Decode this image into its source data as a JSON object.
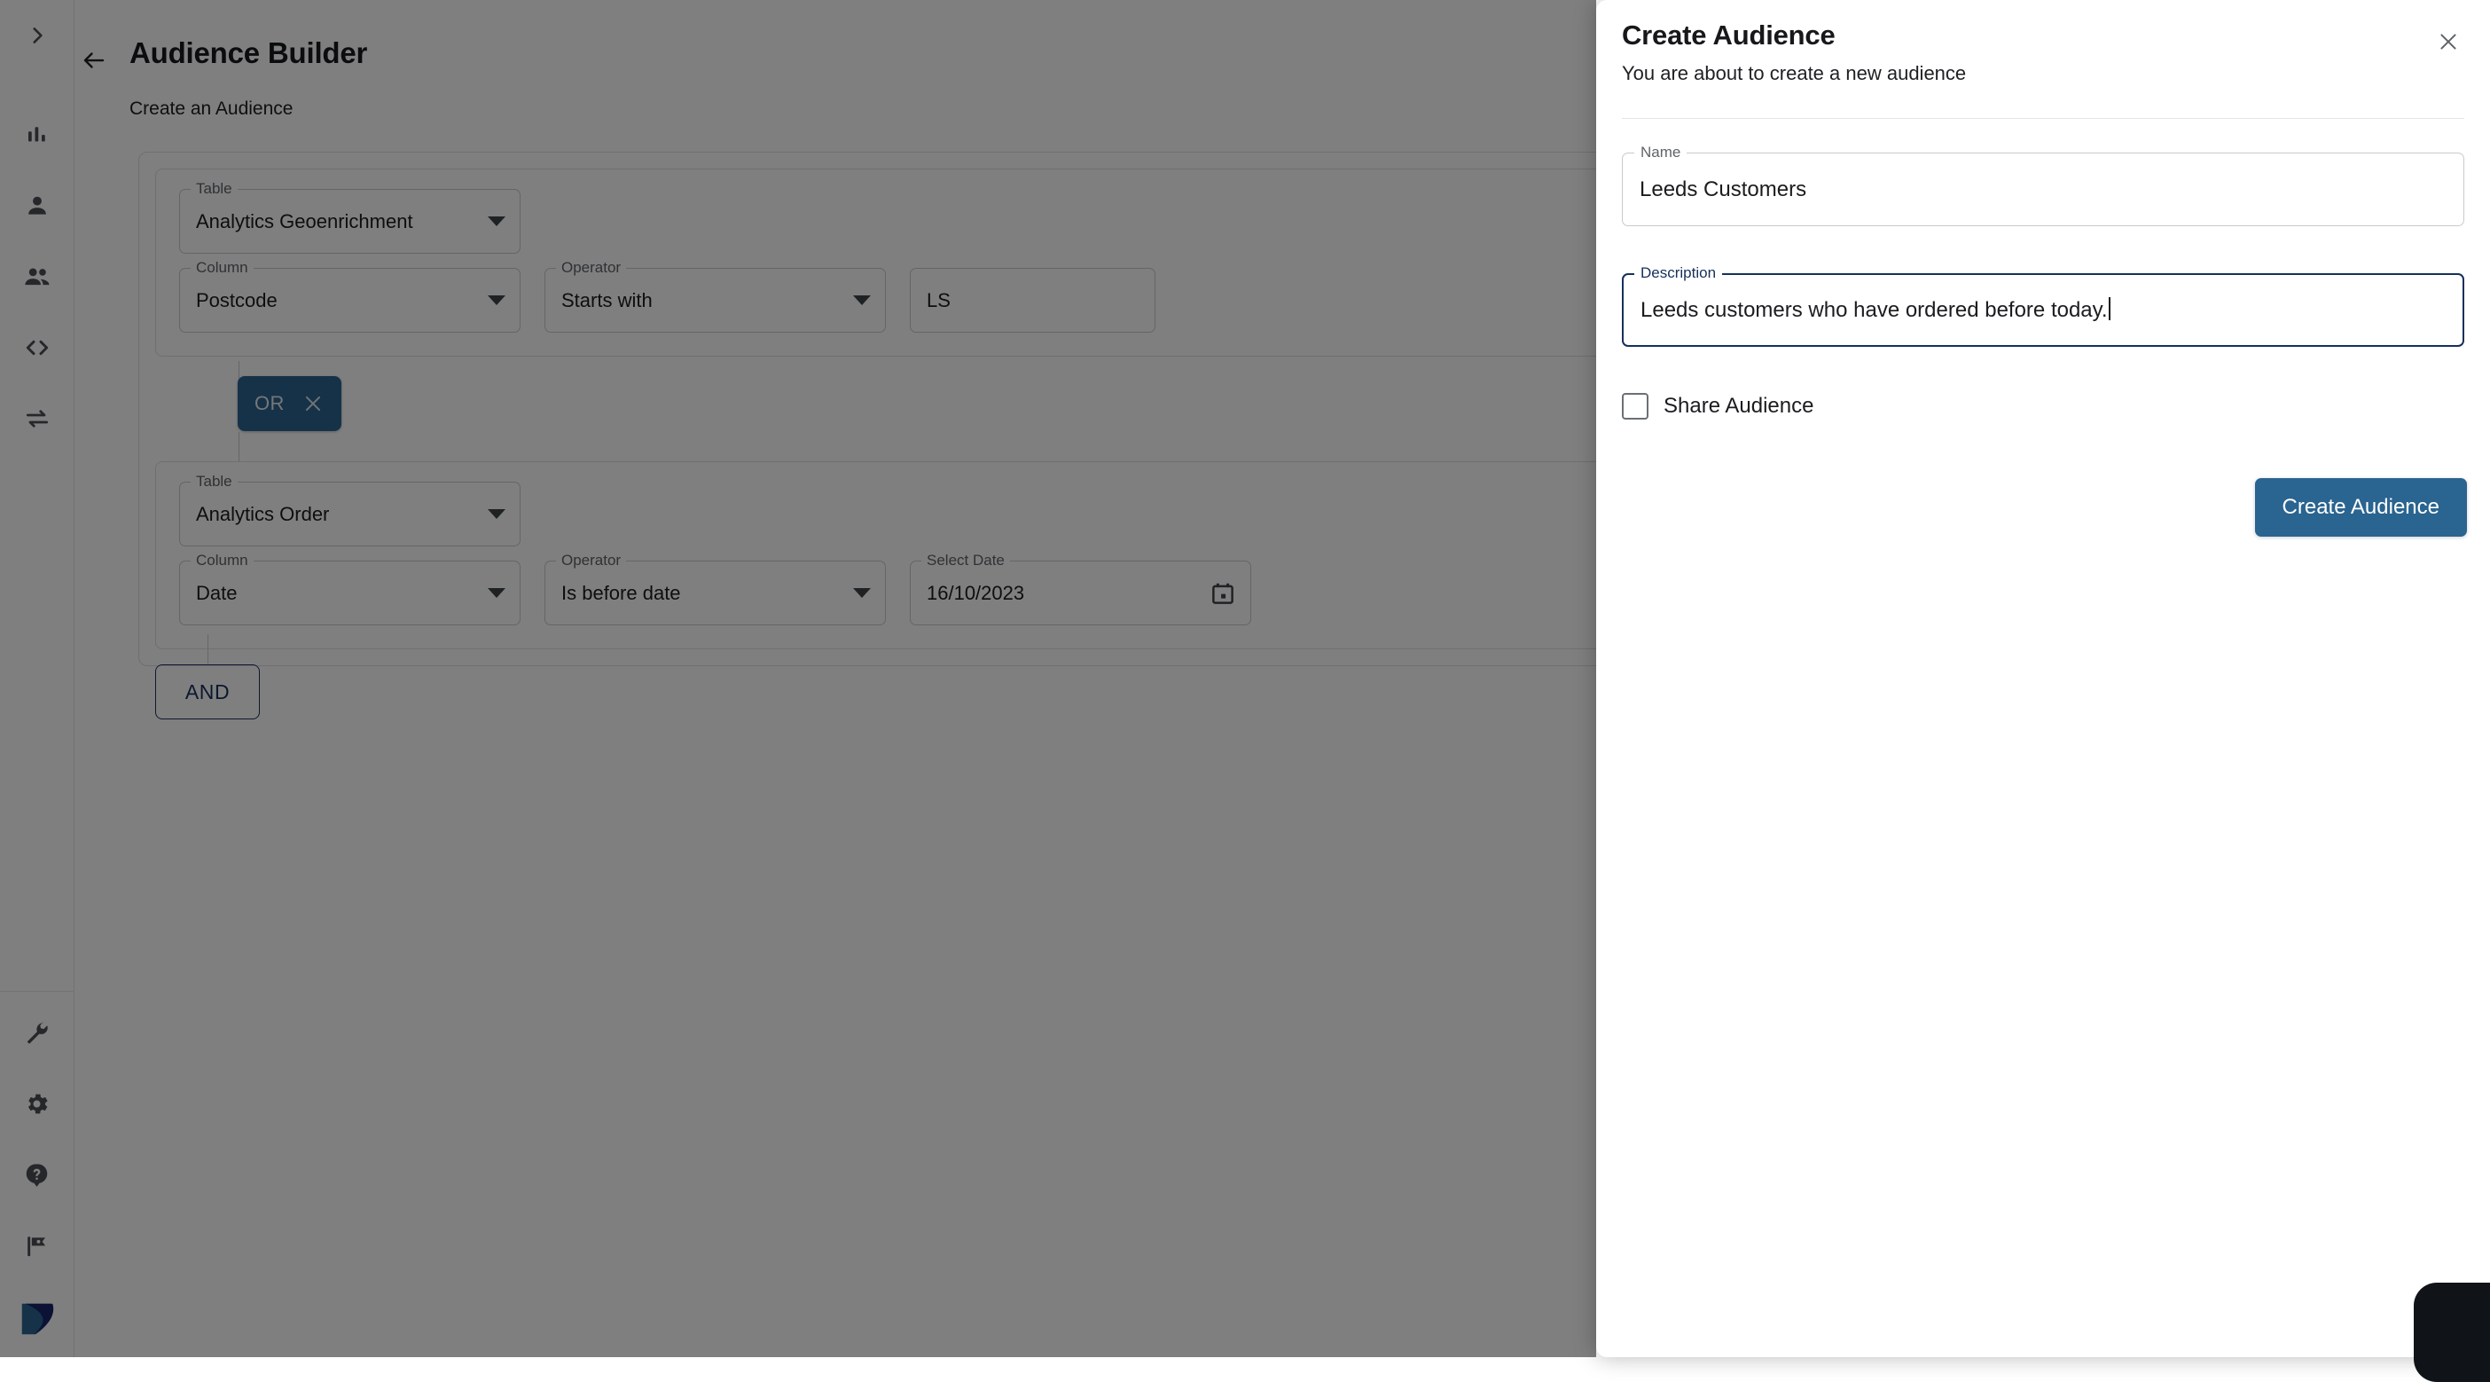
{
  "sidebar": {
    "expand_icon": "chevron-right-icon",
    "items": [
      {
        "icon": "bar-chart-icon",
        "name": "analytics"
      },
      {
        "icon": "person-icon",
        "name": "profile"
      },
      {
        "icon": "people-icon",
        "name": "audiences"
      },
      {
        "icon": "code-brackets-icon",
        "name": "developer"
      },
      {
        "icon": "sync-arrows-icon",
        "name": "integrations"
      }
    ],
    "bottom_items": [
      {
        "icon": "wrench-icon",
        "name": "tools"
      },
      {
        "icon": "gear-icon",
        "name": "settings"
      },
      {
        "icon": "help-circle-icon",
        "name": "help"
      },
      {
        "icon": "flag-icon",
        "name": "feedback"
      }
    ],
    "logo": "app-logo"
  },
  "page": {
    "back_icon": "arrow-left-icon",
    "title": "Audience Builder",
    "subtitle": "Create an Audience"
  },
  "builder": {
    "groups": [
      {
        "fields": [
          {
            "label": "Table",
            "value": "Analytics Geoenrichment",
            "type": "select"
          }
        ],
        "conditions": [
          {
            "label": "Column",
            "value": "Postcode",
            "type": "select"
          },
          {
            "label": "Operator",
            "value": "Starts with",
            "type": "select"
          },
          {
            "label": "",
            "value": "LS",
            "type": "text"
          }
        ]
      },
      {
        "fields": [
          {
            "label": "Table",
            "value": "Analytics Order",
            "type": "select"
          }
        ],
        "conditions": [
          {
            "label": "Column",
            "value": "Date",
            "type": "select"
          },
          {
            "label": "Operator",
            "value": "Is before date",
            "type": "select"
          },
          {
            "label": "Select Date",
            "value": "16/10/2023",
            "type": "date"
          }
        ]
      }
    ],
    "or_chip": {
      "label": "OR",
      "remove_icon": "close-icon"
    },
    "and_button": {
      "label": "AND"
    }
  },
  "panel": {
    "title": "Create Audience",
    "subtitle": "You are about to create a new audience",
    "close_icon": "close-icon",
    "name_field": {
      "label": "Name",
      "value": "Leeds Customers",
      "placeholder": "Name"
    },
    "description_field": {
      "label": "Description",
      "value": "Leeds customers who have ordered before today.",
      "placeholder": "Description",
      "focused": true
    },
    "share_checkbox": {
      "label": "Share Audience",
      "checked": false
    },
    "submit_button": {
      "label": "Create Audience"
    }
  },
  "colors": {
    "accent_blue": "#2a6490",
    "navy": "#16305b",
    "scrim": "rgba(0,0,0,0.50)",
    "field_border": "#c7cace"
  }
}
